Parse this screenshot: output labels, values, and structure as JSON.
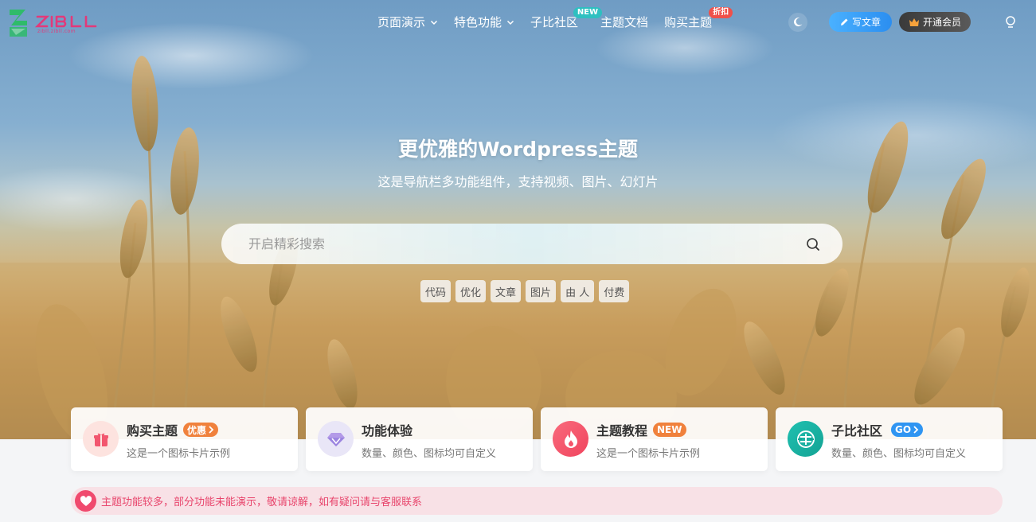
{
  "logo": {
    "text": "ZIBLL",
    "subtitle": "zibll.zibll.com"
  },
  "nav": {
    "items": [
      {
        "label": "页面演示",
        "dropdown": true
      },
      {
        "label": "特色功能",
        "dropdown": true
      },
      {
        "label": "子比社区",
        "badge": "NEW"
      },
      {
        "label": "主题文档"
      },
      {
        "label": "购买主题",
        "badge": "折扣"
      }
    ],
    "theme_toggle_icon": "moon-icon",
    "write_button": "写文章",
    "vip_button": "开通会员",
    "user_icon": "user-icon"
  },
  "hero": {
    "title": "更优雅的Wordpress主题",
    "subtitle": "这是导航栏多功能组件，支持视频、图片、幻灯片",
    "search_placeholder": "开启精彩搜索",
    "tags": [
      "代码",
      "优化",
      "文章",
      "图片",
      "由 人",
      "付费"
    ]
  },
  "cards": [
    {
      "title": "购买主题",
      "badge": "优惠",
      "badge_color": "#f0813c",
      "desc": "这是一个图标卡片示例",
      "icon": "gift-icon",
      "icon_bg": "#fde3df",
      "icon_color": "#f2566e"
    },
    {
      "title": "功能体验",
      "desc": "数量、颜色、图标均可自定义",
      "icon": "diamond-icon",
      "icon_bg": "#e9e6f7",
      "icon_color": "#9b84e0"
    },
    {
      "title": "主题教程",
      "badge": "NEW",
      "badge_color": "#f0813c",
      "desc": "这是一个图标卡片示例",
      "icon": "fire-icon",
      "icon_bg": "#f5536a",
      "icon_color": "#ffffff"
    },
    {
      "title": "子比社区",
      "badge": "GO",
      "badge_color": "#2f95f2",
      "desc": "数量、颜色、图标均可自定义",
      "icon": "community-icon",
      "icon_bg": "#1cb5a4",
      "icon_color": "#ffffff"
    }
  ],
  "notice": {
    "text": "主题功能较多，部分功能未能演示，敬请谅解，如有疑问请与客服联系",
    "icon": "heart-icon"
  },
  "colors": {
    "accent_blue": "#2b8ef0",
    "notice_pink": "#f04a6e",
    "badge_orange": "#f0813c"
  }
}
